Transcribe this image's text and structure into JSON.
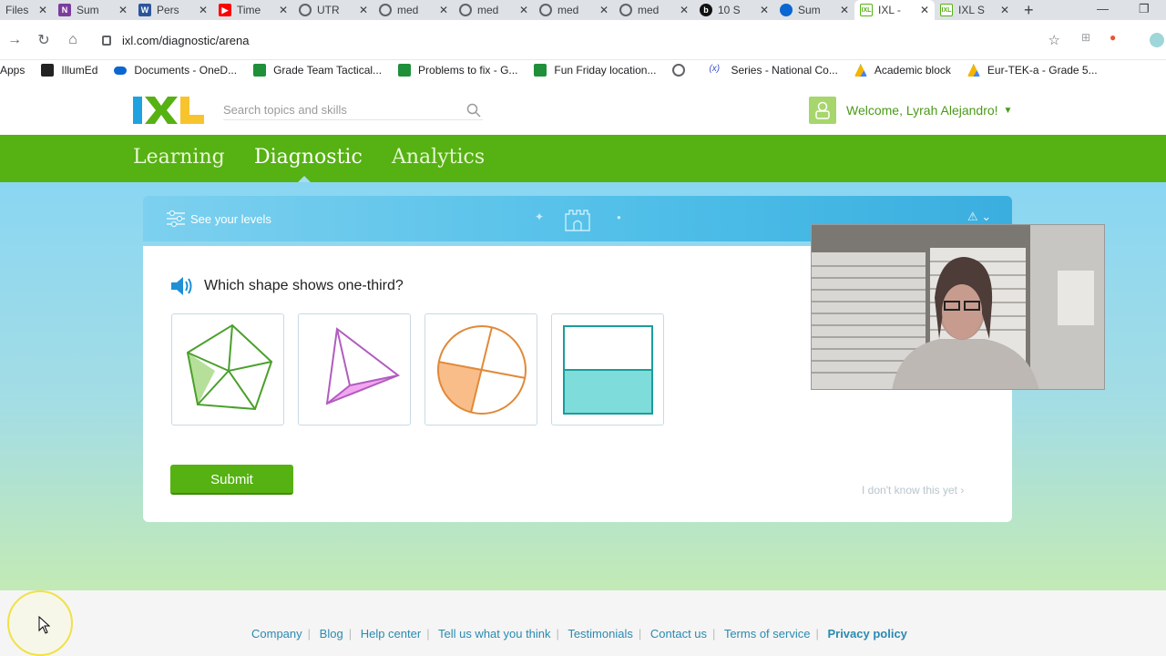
{
  "browser": {
    "tabs": [
      {
        "label": "Files",
        "icon": "files-icon",
        "color": "#888888"
      },
      {
        "label": "Sum",
        "icon": "onenote-icon",
        "color": "#7b3c9c"
      },
      {
        "label": "Pers",
        "icon": "word-icon",
        "color": "#2b579a"
      },
      {
        "label": "Time",
        "icon": "youtube-icon",
        "color": "#ff0000"
      },
      {
        "label": "UTR",
        "icon": "globe-icon",
        "color": "#5f6368"
      },
      {
        "label": "med",
        "icon": "globe-icon",
        "color": "#5f6368"
      },
      {
        "label": "med",
        "icon": "globe-icon",
        "color": "#5f6368"
      },
      {
        "label": "med",
        "icon": "globe-icon",
        "color": "#5f6368"
      },
      {
        "label": "med",
        "icon": "globe-icon",
        "color": "#5f6368"
      },
      {
        "label": "10 S",
        "icon": "b-icon",
        "color": "#111111"
      },
      {
        "label": "Sum",
        "icon": "onedrive-icon",
        "color": "#0a66d0"
      },
      {
        "label": "IXL -",
        "icon": "ixl-icon",
        "color": "#56b113",
        "active": true
      },
      {
        "label": "IXL S",
        "icon": "ixl-icon",
        "color": "#56b113"
      }
    ],
    "url": "ixl.com/diagnostic/arena",
    "bookmarks": [
      {
        "label": "Apps",
        "icon": "apps-icon",
        "color": "#5f6368"
      },
      {
        "label": "IllumEd",
        "icon": "illumed-icon",
        "color": "#333333"
      },
      {
        "label": "Documents - OneD...",
        "icon": "onedrive-icon",
        "color": "#0a66d0"
      },
      {
        "label": "Grade Team Tactical...",
        "icon": "sheets-icon",
        "color": "#1f8f3a"
      },
      {
        "label": "Problems to fix - G...",
        "icon": "sheets-icon",
        "color": "#1f8f3a"
      },
      {
        "label": "Fun Friday location...",
        "icon": "sheets-icon",
        "color": "#1f8f3a"
      },
      {
        "label": "",
        "icon": "globe-icon",
        "color": "#5f6368"
      },
      {
        "label": "Series - National Co...",
        "icon": "series-icon",
        "color": "#3c4fc8"
      },
      {
        "label": "Academic block",
        "icon": "drive-icon",
        "color": "#f4b400"
      },
      {
        "label": "Eur-TEK-a - Grade 5...",
        "icon": "drive-icon",
        "color": "#f4b400"
      }
    ]
  },
  "header": {
    "search_placeholder": "Search topics and skills",
    "welcome": "Welcome, Lyrah Alejandro!"
  },
  "nav": {
    "tabs": [
      "Learning",
      "Diagnostic",
      "Analytics"
    ],
    "active": "Diagnostic"
  },
  "diagnostic": {
    "levels_label": "See your levels",
    "question": "Which shape shows one-third?",
    "choices": [
      "pentagon-shape",
      "triangle-shape",
      "circle-shape",
      "rectangle-shape"
    ],
    "submit_label": "Submit",
    "dont_know_label": "I don't know this yet ›"
  },
  "footer": {
    "links": [
      "Company",
      "Blog",
      "Help center",
      "Tell us what you think",
      "Testimonials",
      "Contact us",
      "Terms of service"
    ],
    "privacy": "Privacy policy"
  },
  "colors": {
    "brand_green": "#56b113",
    "link_blue": "#2a8ab1"
  }
}
